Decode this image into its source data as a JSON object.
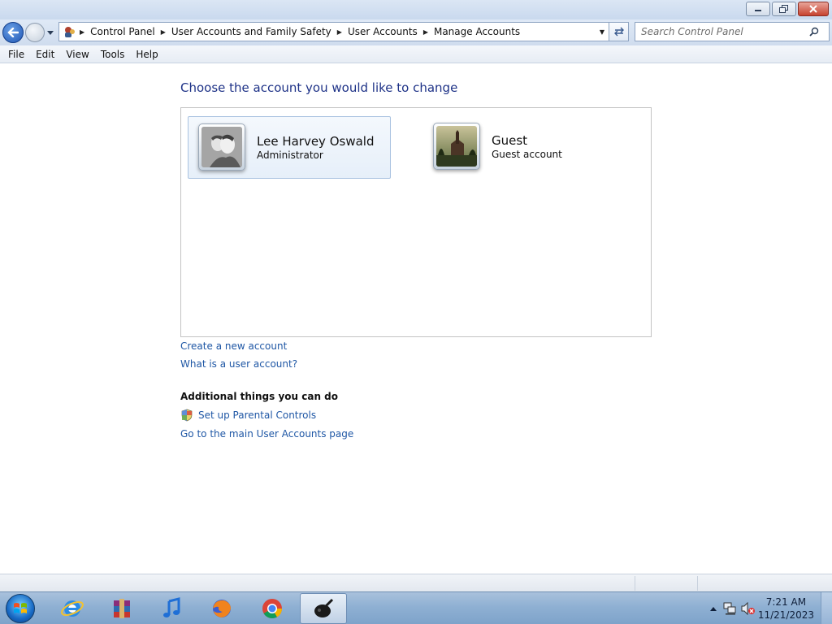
{
  "window": {
    "controls": [
      "minimize",
      "restore",
      "close"
    ]
  },
  "navigation": {
    "breadcrumb": [
      "Control Panel",
      "User Accounts and Family Safety",
      "User Accounts",
      "Manage Accounts"
    ],
    "search_placeholder": "Search Control Panel"
  },
  "menu": [
    "File",
    "Edit",
    "View",
    "Tools",
    "Help"
  ],
  "main": {
    "title": "Choose the account you would like to change",
    "accounts": [
      {
        "name": "Lee Harvey Oswald",
        "type": "Administrator",
        "selected": true,
        "avatar_icon": "portrait-photo-icon"
      },
      {
        "name": "Guest",
        "type": "Guest account",
        "selected": false,
        "avatar_icon": "church-landscape-icon"
      }
    ],
    "links": {
      "create_account": "Create a new account",
      "what_is_account": "What is a user account?"
    },
    "additional": {
      "heading": "Additional things you can do",
      "parental_controls": "Set up Parental Controls",
      "main_page": "Go to the main User Accounts page"
    }
  },
  "taskbar": {
    "items": [
      "start-orb-icon",
      "internet-explorer-icon",
      "winrar-icon",
      "itunes-icon",
      "firefox-icon",
      "chrome-icon",
      "paint-app-icon"
    ],
    "active_item": "paint-app-icon",
    "tray_icons": [
      "show-hidden-icons-arrow",
      "network-icon",
      "volume-muted-icon"
    ],
    "clock_time": "7:21 AM",
    "clock_date": "11/21/2023"
  },
  "colors": {
    "title_blue": "#1e3287",
    "link_blue": "#1f57a5",
    "selected_tile_border": "#a9c2e0"
  }
}
